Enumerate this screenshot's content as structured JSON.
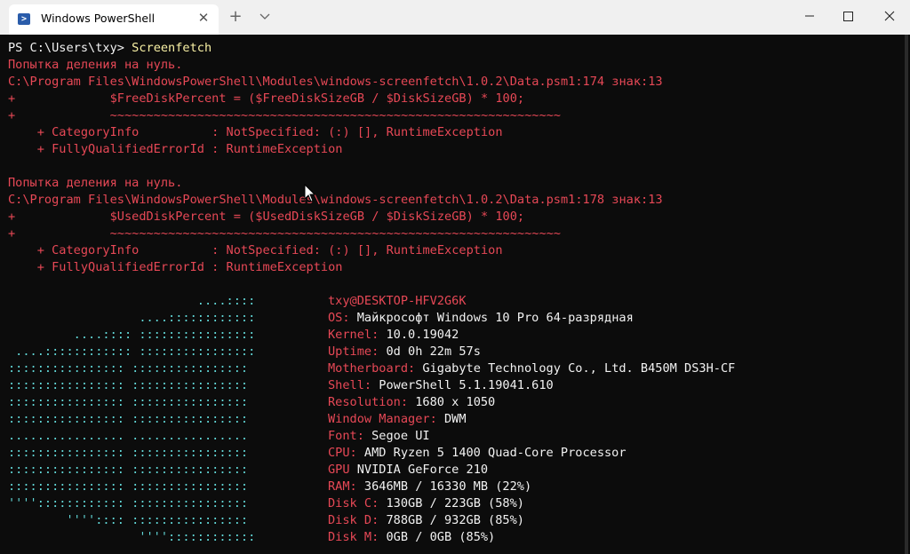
{
  "window": {
    "tab_title": "Windows PowerShell",
    "tab_icon_glyph": ">",
    "close_tab": "✕",
    "new_tab": "+"
  },
  "terminal": {
    "prompt": "PS C:\\Users\\txy> ",
    "command": "Screenfetch",
    "errors": [
      {
        "msg": "Попытка деления на нуль.",
        "path": "C:\\Program Files\\WindowsPowerShell\\Modules\\windows-screenfetch\\1.0.2\\Data.psm1:174 знак:13",
        "code": "+             $FreeDiskPercent = ($FreeDiskSizeGB / $DiskSizeGB) * 100;",
        "tilde": "+             ~~~~~~~~~~~~~~~~~~~~~~~~~~~~~~~~~~~~~~~~~~~~~~~~~~~~~~~~~~~~~~",
        "category": "    + CategoryInfo          : NotSpecified: (:) [], RuntimeException",
        "fqid": "    + FullyQualifiedErrorId : RuntimeException"
      },
      {
        "msg": "Попытка деления на нуль.",
        "path": "C:\\Program Files\\WindowsPowerShell\\Modules\\windows-screenfetch\\1.0.2\\Data.psm1:178 знак:13",
        "code": "+             $UsedDiskPercent = ($UsedDiskSizeGB / $DiskSizeGB) * 100;",
        "tilde": "+             ~~~~~~~~~~~~~~~~~~~~~~~~~~~~~~~~~~~~~~~~~~~~~~~~~~~~~~~~~~~~~~",
        "category": "    + CategoryInfo          : NotSpecified: (:) [], RuntimeException",
        "fqid": "    + FullyQualifiedErrorId : RuntimeException"
      }
    ],
    "logo": [
      "                          ....::::",
      "                  ....::::::::::::",
      "         ....:::: ::::::::::::::::",
      " ....:::::::::::: ::::::::::::::::",
      ":::::::::::::::: ::::::::::::::::",
      ":::::::::::::::: ::::::::::::::::",
      ":::::::::::::::: ::::::::::::::::",
      ":::::::::::::::: ::::::::::::::::",
      "................ ................",
      ":::::::::::::::: ::::::::::::::::",
      ":::::::::::::::: ::::::::::::::::",
      ":::::::::::::::: ::::::::::::::::",
      "'''':::::::::::: ::::::::::::::::",
      "        '''':::: ::::::::::::::::",
      "                  ''''::::::::::::"
    ],
    "info": [
      {
        "label": "txy@DESKTOP-HFV2G6K",
        "value": ""
      },
      {
        "label": "OS: ",
        "value": "Майкрософт Windows 10 Pro 64-разрядная"
      },
      {
        "label": "Kernel: ",
        "value": "10.0.19042"
      },
      {
        "label": "Uptime: ",
        "value": "0d 0h 22m 57s"
      },
      {
        "label": "Motherboard: ",
        "value": "Gigabyte Technology Co., Ltd. B450M DS3H-CF"
      },
      {
        "label": "Shell: ",
        "value": "PowerShell 5.1.19041.610"
      },
      {
        "label": "Resolution: ",
        "value": "1680 x 1050"
      },
      {
        "label": "Window Manager: ",
        "value": "DWM"
      },
      {
        "label": "Font: ",
        "value": "Segoe UI"
      },
      {
        "label": "CPU: ",
        "value": "AMD Ryzen 5 1400 Quad-Core Processor"
      },
      {
        "label": "GPU ",
        "value": "NVIDIA GeForce 210"
      },
      {
        "label": "RAM: ",
        "value": "3646MB / 16330 MB (22%)"
      },
      {
        "label": "Disk C: ",
        "value": "130GB / 223GB (58%)"
      },
      {
        "label": "Disk D: ",
        "value": "788GB / 932GB (85%)"
      },
      {
        "label": "Disk M: ",
        "value": "0GB / 0GB (85%)"
      }
    ]
  },
  "colors": {
    "error": "#e74856",
    "command": "#f9f1a5",
    "logo": "#61d6d6",
    "background": "#0c0c0c"
  }
}
